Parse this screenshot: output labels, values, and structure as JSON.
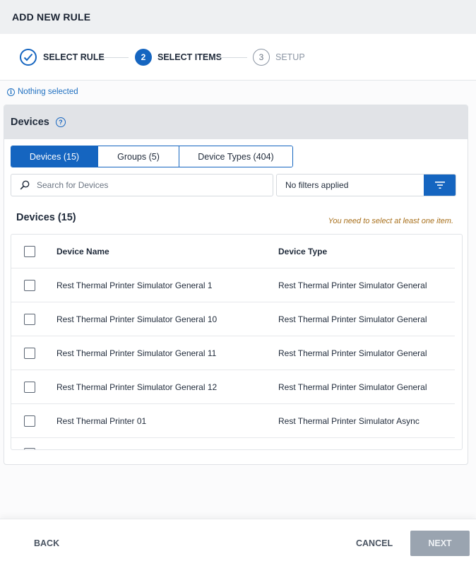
{
  "header": {
    "title": "ADD NEW RULE"
  },
  "stepper": {
    "steps": [
      {
        "number": "1",
        "label": "SELECT RULE",
        "state": "done"
      },
      {
        "number": "2",
        "label": "SELECT ITEMS",
        "state": "active"
      },
      {
        "number": "3",
        "label": "SETUP",
        "state": "todo"
      }
    ]
  },
  "selection_info": "Nothing selected",
  "panel": {
    "title": "Devices",
    "tabs": [
      {
        "label": "Devices (15)",
        "active": true
      },
      {
        "label": "Groups (5)",
        "active": false
      },
      {
        "label": "Device Types (404)",
        "active": false
      }
    ],
    "search": {
      "placeholder": "Search for Devices",
      "value": ""
    },
    "filter": {
      "label": "No filters applied"
    },
    "list_title": "Devices (15)",
    "warning": "You need to select at least one item.",
    "table": {
      "columns": [
        "Device Name",
        "Device Type"
      ],
      "rows": [
        {
          "name": "Rest Thermal Printer Simulator General 1",
          "type": "Rest Thermal Printer Simulator General"
        },
        {
          "name": "Rest Thermal Printer Simulator General 10",
          "type": "Rest Thermal Printer Simulator General"
        },
        {
          "name": "Rest Thermal Printer Simulator General 11",
          "type": "Rest Thermal Printer Simulator General"
        },
        {
          "name": "Rest Thermal Printer Simulator General 12",
          "type": "Rest Thermal Printer Simulator General"
        },
        {
          "name": "Rest Thermal Printer 01",
          "type": "Rest Thermal Printer Simulator Async"
        }
      ]
    }
  },
  "footer": {
    "back": "BACK",
    "cancel": "CANCEL",
    "next": "NEXT"
  },
  "colors": {
    "primary": "#1565c0",
    "warning": "#a8701c",
    "disabled": "#9aa4b0"
  }
}
